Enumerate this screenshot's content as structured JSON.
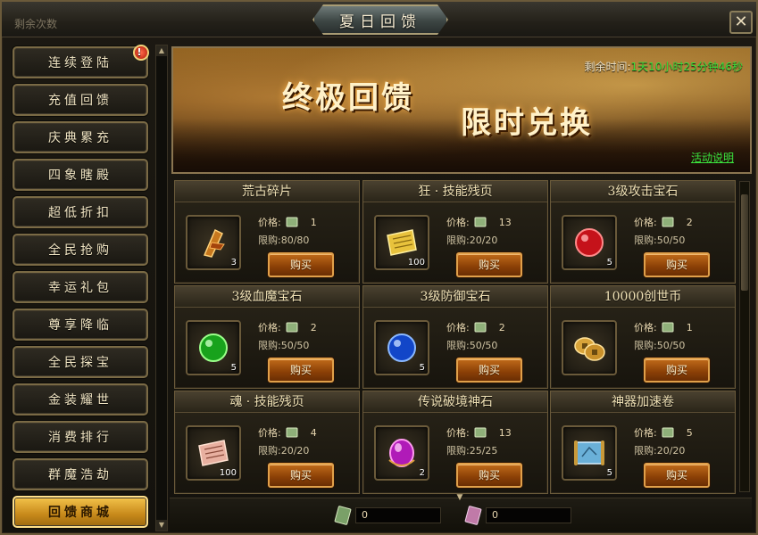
{
  "window": {
    "title": "夏日回馈",
    "remaining_label": "剩余次数",
    "close_label": "✕"
  },
  "sidebar": {
    "items": [
      {
        "label": "连续登陆",
        "alert": "!"
      },
      {
        "label": "充值回馈"
      },
      {
        "label": "庆典累充"
      },
      {
        "label": "四象瞎殿"
      },
      {
        "label": "超低折扣"
      },
      {
        "label": "全民抢购"
      },
      {
        "label": "幸运礼包"
      },
      {
        "label": "尊享降临"
      },
      {
        "label": "全民探宝"
      },
      {
        "label": "金装耀世"
      },
      {
        "label": "消费排行"
      },
      {
        "label": "群魔浩劫"
      },
      {
        "label": "回馈商城",
        "active": true
      }
    ]
  },
  "banner": {
    "title_1": "终极回馈",
    "title_2": "限时兑换",
    "timer_label": "剩余时间:",
    "timer_value": "1天10小时25分钟46秒",
    "event_link": "活动说明"
  },
  "shop": {
    "price_label": "价格:",
    "limit_label": "限购:",
    "buy_label": "购买",
    "items": [
      {
        "name": "荒古碎片",
        "qty": "3",
        "price": "1",
        "limit": "80/80",
        "icon": "ancient-shard-icon"
      },
      {
        "name": "狂 · 技能残页",
        "qty": "100",
        "price": "13",
        "limit": "20/20",
        "icon": "skill-page-gold-icon"
      },
      {
        "name": "3级攻击宝石",
        "qty": "5",
        "price": "2",
        "limit": "50/50",
        "icon": "red-gem-icon"
      },
      {
        "name": "3级血魔宝石",
        "qty": "5",
        "price": "2",
        "limit": "50/50",
        "icon": "green-gem-icon"
      },
      {
        "name": "3级防御宝石",
        "qty": "5",
        "price": "2",
        "limit": "50/50",
        "icon": "blue-gem-icon"
      },
      {
        "name": "10000创世币",
        "qty": "",
        "price": "1",
        "limit": "50/50",
        "icon": "coins-icon"
      },
      {
        "name": "魂 · 技能残页",
        "qty": "100",
        "price": "4",
        "limit": "20/20",
        "icon": "skill-page-pink-icon"
      },
      {
        "name": "传说破境神石",
        "qty": "2",
        "price": "13",
        "limit": "25/25",
        "icon": "purple-stone-icon"
      },
      {
        "name": "神器加速卷",
        "qty": "5",
        "price": "5",
        "limit": "20/20",
        "icon": "scroll-icon"
      }
    ]
  },
  "footer": {
    "currency_a": "0",
    "currency_b": "0"
  },
  "colors": {
    "accent_gold": "#f3c34a",
    "timer_green": "#38e03b",
    "buy_orange": "#c06a1a"
  }
}
